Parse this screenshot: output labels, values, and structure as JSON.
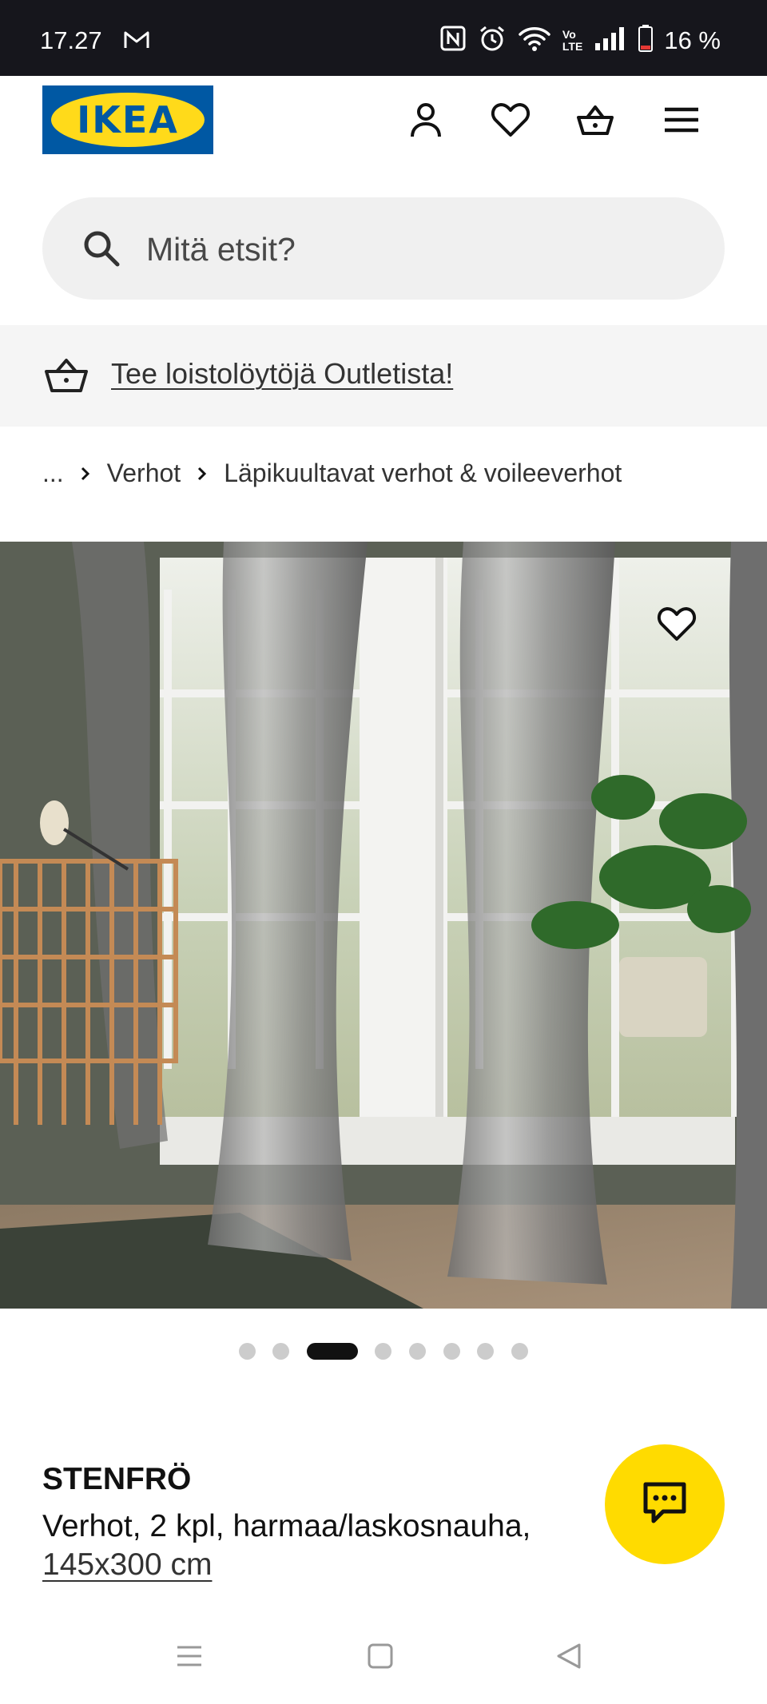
{
  "status_bar": {
    "time": "17.27",
    "battery": "16 %",
    "icons": [
      "gmail-icon",
      "nfc-icon",
      "alarm-icon",
      "wifi-icon",
      "volte-icon",
      "signal-icon",
      "battery-icon"
    ],
    "volte_top": "Vo",
    "volte_bottom": "LTE"
  },
  "header": {
    "logo_text": "IKEA",
    "icons": [
      "account-icon",
      "wishlist-heart-icon",
      "shopping-basket-icon",
      "menu-icon"
    ]
  },
  "search": {
    "placeholder": "Mitä etsit?"
  },
  "promo": {
    "text": "Tee loistolöytöjä Outletista!"
  },
  "breadcrumb": {
    "ellipsis": "...",
    "items": [
      "Verhot",
      "Läpikuultavat verhot & voileeverhot"
    ]
  },
  "carousel": {
    "total": 8,
    "active_index": 3
  },
  "product": {
    "name": "STENFRÖ",
    "description": "Verhot, 2 kpl, harmaa/laskosnauha,",
    "size": "145x300 cm"
  },
  "colors": {
    "ikea_blue": "#0058a3",
    "ikea_yellow": "#ffda1a",
    "chat_yellow": "#ffdb00",
    "status_bar_bg": "#16161c"
  }
}
